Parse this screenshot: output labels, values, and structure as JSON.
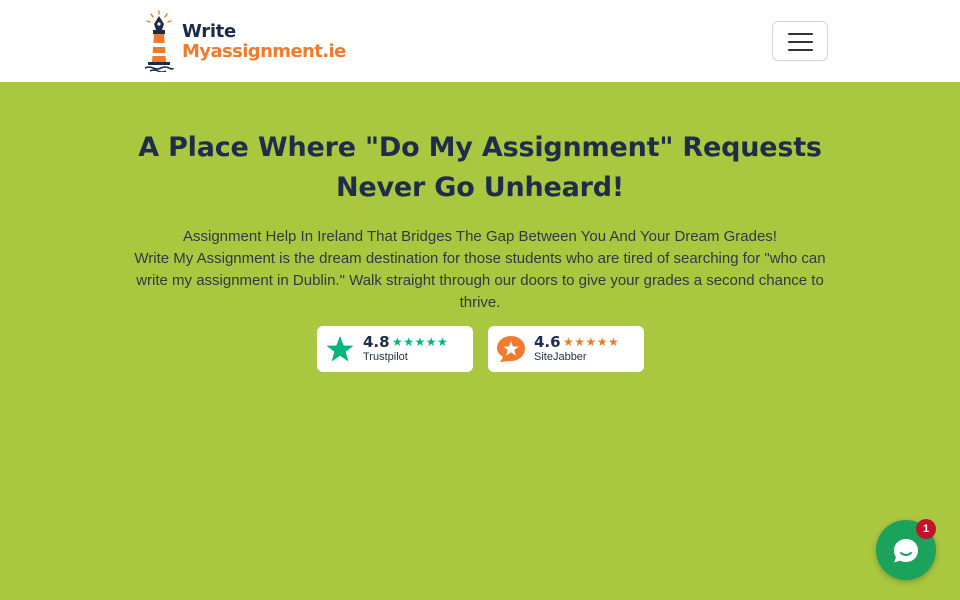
{
  "header": {
    "logo": {
      "line1": "Write",
      "line2": "Myassignment.ie"
    },
    "menu_toggle": {
      "icon": "hamburger-menu-icon"
    }
  },
  "hero": {
    "title_line1": "A Place Where \"Do My Assignment\" Requests",
    "title_line2": "Never Go Unheard!",
    "subtitle": "Assignment Help In Ireland That Bridges The Gap Between You And Your Dream Grades!",
    "description": "Write My Assignment is the dream destination for those students who are tired of searching for \"who can write my assignment in Dublin.\" Walk straight through our doors to give your grades a second chance to thrive."
  },
  "ratings": [
    {
      "score": "4.8",
      "name": "Trustpilot",
      "stars": "★★★★★",
      "star_count": 5,
      "icon": "trustpilot-star-icon",
      "color": "#00b67a"
    },
    {
      "score": "4.6",
      "name": "SiteJabber",
      "stars": "★★★★★",
      "star_count": 5,
      "icon": "sitejabber-icon",
      "color": "#f07b2c"
    }
  ],
  "chat": {
    "badge_count": "1",
    "icon": "chat-bubble-icon",
    "color": "#1ba35c"
  },
  "colors": {
    "background": "#a9c73f",
    "header": "#ffffff",
    "brand_orange": "#f07b2c",
    "navy": "#1f2d4a"
  }
}
